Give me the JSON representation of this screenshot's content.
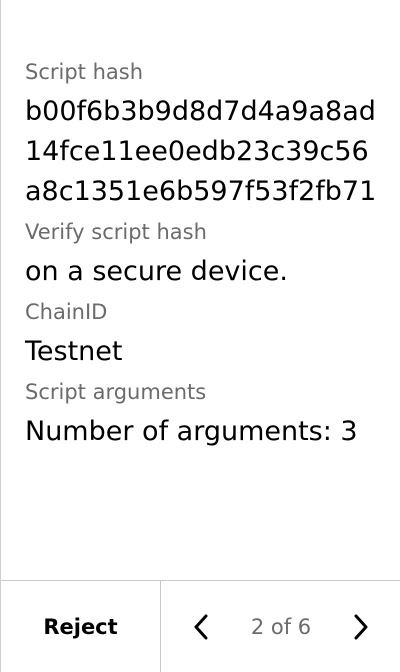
{
  "fields": {
    "script_hash": {
      "label": "Script hash",
      "value": "b00f6b3b9d8d7d4a9a8ad14fce11ee0edb23c39c56a8c1351e6b597f53f2fb71"
    },
    "verify": {
      "label": "Verify script hash",
      "value": "on a secure device."
    },
    "chain": {
      "label": "ChainID",
      "value": "Testnet"
    },
    "arguments": {
      "label": "Script arguments",
      "value": "Number of arguments: 3"
    }
  },
  "footer": {
    "reject_label": "Reject",
    "page_indicator": "2 of 6",
    "prev_icon": "chevron-left-icon",
    "next_icon": "chevron-right-icon"
  }
}
